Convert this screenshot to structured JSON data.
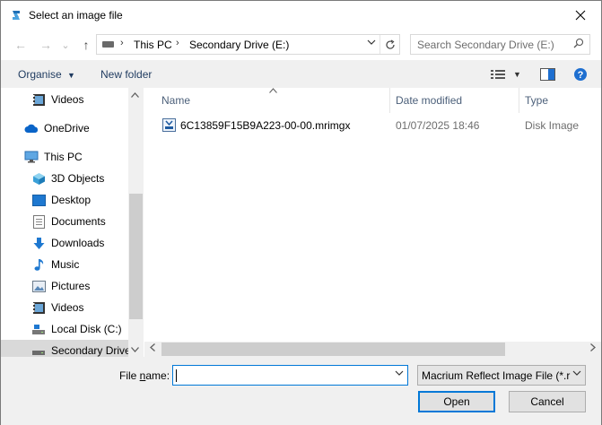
{
  "window": {
    "title": "Select an image file"
  },
  "nav": {
    "back": "←",
    "forward": "→",
    "recent": "⌄",
    "up": "↑",
    "breadcrumb": [
      "This PC",
      "Secondary Drive (E:)"
    ],
    "separator": "›",
    "search_placeholder": "Search Secondary Drive (E:)"
  },
  "toolbar": {
    "organise": "Organise",
    "new_folder": "New folder"
  },
  "sidebar": {
    "items": [
      {
        "label": "Videos",
        "icon": "video-folder-icon"
      },
      {
        "label": "OneDrive",
        "icon": "cloud-icon"
      },
      {
        "label": "This PC",
        "icon": "computer-icon"
      },
      {
        "label": "3D Objects",
        "icon": "cube-icon"
      },
      {
        "label": "Desktop",
        "icon": "desktop-icon"
      },
      {
        "label": "Documents",
        "icon": "document-icon"
      },
      {
        "label": "Downloads",
        "icon": "download-icon"
      },
      {
        "label": "Music",
        "icon": "music-icon"
      },
      {
        "label": "Pictures",
        "icon": "picture-icon"
      },
      {
        "label": "Videos",
        "icon": "video-folder-icon"
      },
      {
        "label": "Local Disk (C:)",
        "icon": "local-disk-icon"
      },
      {
        "label": "Secondary Drive",
        "icon": "drive-icon",
        "selected": true
      }
    ]
  },
  "columns": {
    "name": "Name",
    "date": "Date modified",
    "type": "Type"
  },
  "files": [
    {
      "name": "6C13859F15B9A223-00-00.mrimgx",
      "date": "01/07/2025 18:46",
      "type": "Disk Image"
    }
  ],
  "footer": {
    "file_name_label_pre": "File ",
    "file_name_label_accel": "n",
    "file_name_label_post": "ame:",
    "file_name_value": "",
    "file_type": "Macrium Reflect Image File (*.r",
    "open": "Open",
    "cancel": "Cancel"
  },
  "colors": {
    "accent": "#0078d7",
    "selected_bg": "#d9d9d9",
    "header_text": "#4c607a"
  }
}
